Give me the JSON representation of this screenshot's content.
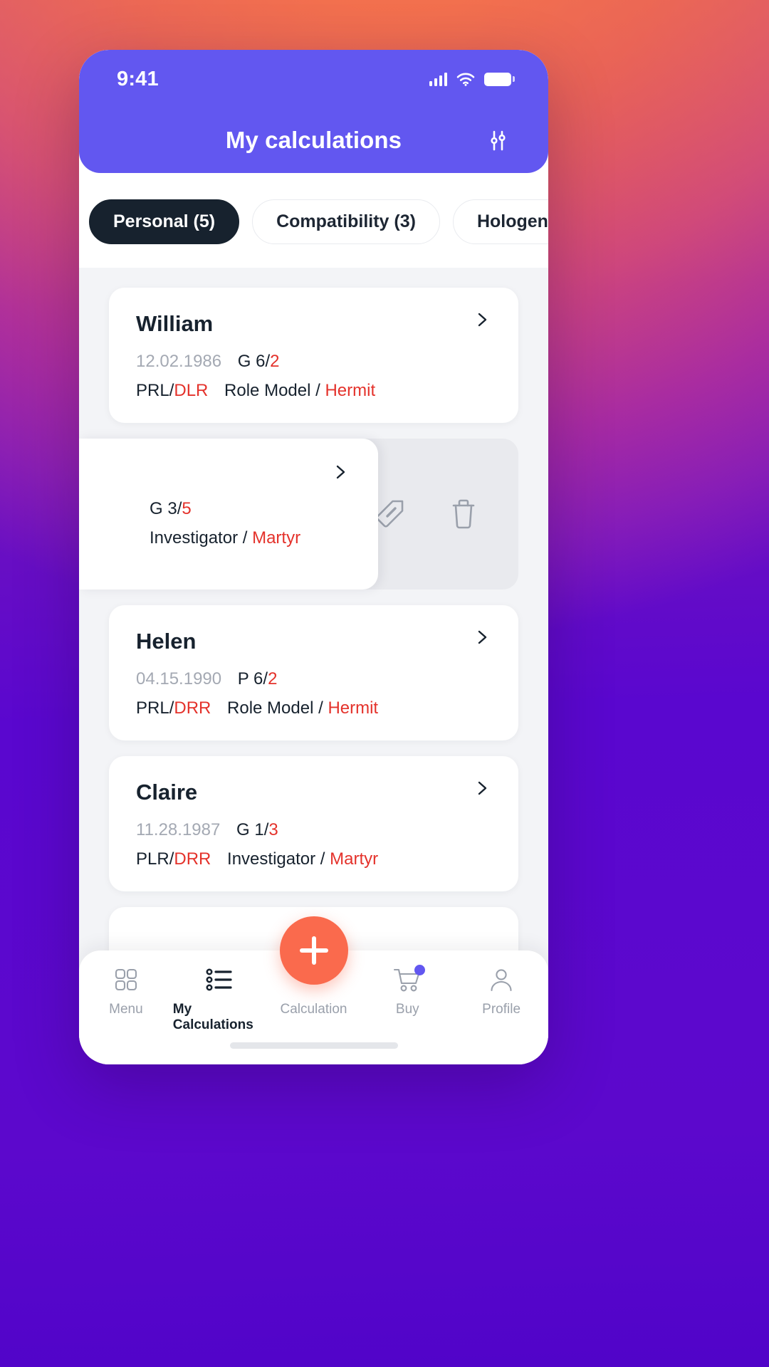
{
  "status_bar": {
    "time": "9:41",
    "signal_icon": "cellular-signal-icon",
    "wifi_icon": "wifi-icon",
    "battery_icon": "battery-full-icon"
  },
  "header": {
    "title": "My calculations",
    "filter_icon": "sliders-filter-icon",
    "background_color": "#6257f0"
  },
  "tabs": [
    {
      "label": "Personal (5)",
      "active": true
    },
    {
      "label": "Compatibility (3)",
      "active": false
    },
    {
      "label": "Hologenetics (",
      "active": false
    }
  ],
  "cards": [
    {
      "name": "William",
      "date": "12.02.1986",
      "code_prefix": "G",
      "code_left": "6/",
      "code_right": "2",
      "profile_left": "PRL/",
      "profile_right": "DLR",
      "archetype_left": "Role Model / ",
      "archetype_right": "Hermit",
      "chevron_icon": "chevron-right-icon",
      "swiped": false
    },
    {
      "name": "",
      "date": "",
      "code_prefix": "G",
      "code_left": "3/",
      "code_right": "5",
      "profile_left": "",
      "profile_right": "",
      "archetype_left": "Investigator / ",
      "archetype_right": "Martyr",
      "chevron_icon": "chevron-right-icon",
      "swiped": true,
      "actions": [
        {
          "name": "tag-edit-icon",
          "label": "Tag"
        },
        {
          "name": "trash-delete-icon",
          "label": "Delete"
        }
      ]
    },
    {
      "name": "Helen",
      "date": "04.15.1990",
      "code_prefix": "P",
      "code_left": "6/",
      "code_right": "2",
      "profile_left": "PRL/",
      "profile_right": "DRR",
      "archetype_left": "Role Model / ",
      "archetype_right": "Hermit",
      "chevron_icon": "chevron-right-icon",
      "swiped": false
    },
    {
      "name": "Claire",
      "date": "11.28.1987",
      "code_prefix": "G",
      "code_left": "1/",
      "code_right": "3",
      "profile_left": "PLR/",
      "profile_right": "DRR",
      "archetype_left": "Investigator / ",
      "archetype_right": "Martyr",
      "chevron_icon": "chevron-right-icon",
      "swiped": false
    }
  ],
  "bottom_nav": {
    "items": [
      {
        "label": "Menu",
        "icon": "grid-menu-icon",
        "active": false
      },
      {
        "label": "My Calculations",
        "icon": "list-bullets-icon",
        "active": true
      },
      {
        "label": "Calculation",
        "icon": "plus-icon",
        "active": false
      },
      {
        "label": "Buy",
        "icon": "shopping-cart-icon",
        "active": false,
        "badge": true
      },
      {
        "label": "Profile",
        "icon": "person-profile-icon",
        "active": false
      }
    ],
    "fab_color": "#fa6a4d",
    "badge_color": "#6257f0"
  },
  "colors": {
    "accent_purple": "#6257f0",
    "accent_orange": "#fa6a4d",
    "highlight_red": "#e4322b",
    "dark": "#17222e",
    "muted": "#a4a9b3"
  }
}
